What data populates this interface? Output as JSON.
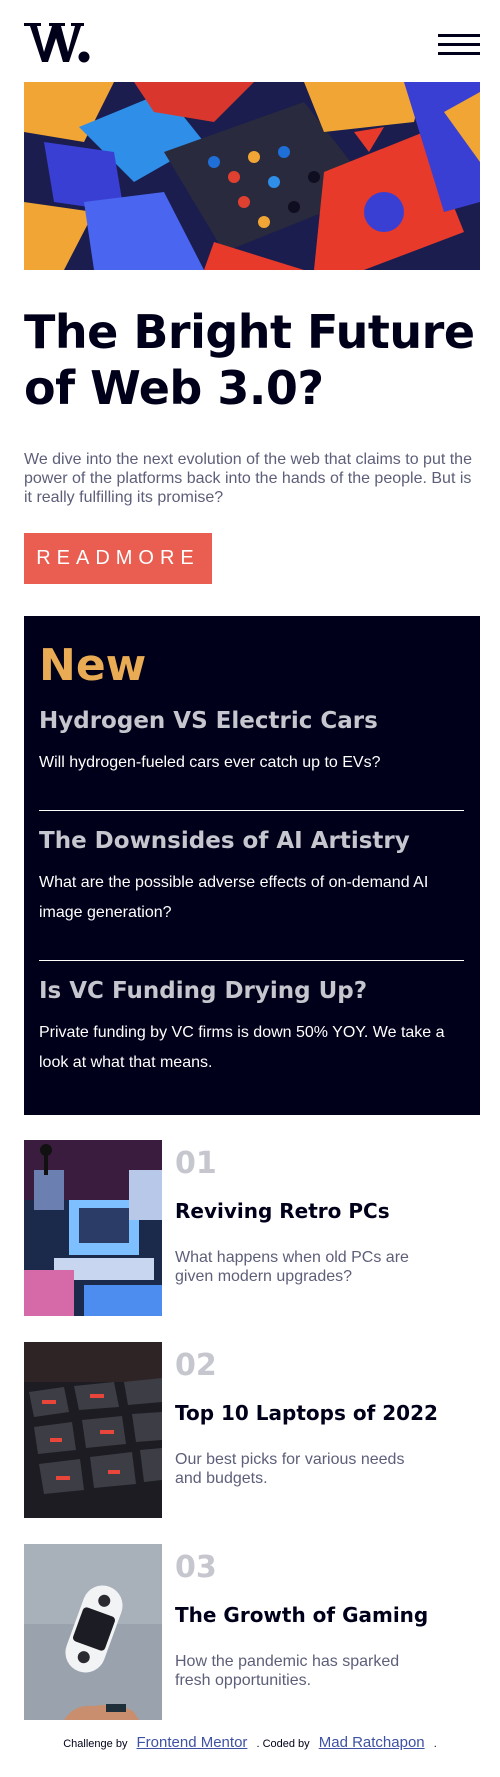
{
  "header": {
    "logo_icon": "w-logo-icon",
    "menu_icon": "hamburger-menu-icon"
  },
  "hero": {
    "image": "abstract-colorful-blocks-image",
    "title": "The Bright Future of Web 3.0?",
    "description": "We dive into the next evolution of the web that claims to put the power of the platforms back into the hands of the people. But is it really fulfilling its promise?",
    "read_more_label": "READMORE"
  },
  "new_section": {
    "heading": "New",
    "items": [
      {
        "title": "Hydrogen VS Electric Cars",
        "description": "Will hydrogen-fueled cars ever catch up to EVs?"
      },
      {
        "title": "The Downsides of AI Artistry",
        "description": "What are the possible adverse effects of on-demand AI image generation?"
      },
      {
        "title": "Is VC Funding Drying Up?",
        "description": "Private funding by VC firms is down 50% YOY. We take a look at what that means."
      }
    ]
  },
  "articles": [
    {
      "number": "01",
      "title": "Reviving Retro PCs",
      "description": "What happens when old PCs are given modern upgrades?",
      "image": "retro-pc-image"
    },
    {
      "number": "02",
      "title": "Top 10 Laptops of 2022",
      "description": "Our best picks for various needs and budgets.",
      "image": "laptop-keyboard-image"
    },
    {
      "number": "03",
      "title": "The Growth of Gaming",
      "description": "How the pandemic has sparked fresh opportunities.",
      "image": "game-controller-image"
    }
  ],
  "footer": {
    "challenge_prefix": "Challenge by",
    "challenge_link": "Frontend Mentor",
    "coded_prefix": ". Coded by",
    "coded_link": "Mad Ratchapon",
    "suffix": "."
  },
  "colors": {
    "dark_navy": "#00001a",
    "soft_orange": "#e9ab53",
    "soft_red": "#ea5e51",
    "grayish_blue": "#5d5f79",
    "light_gray": "#c5c6ce",
    "link_blue": "#3e52a3"
  }
}
